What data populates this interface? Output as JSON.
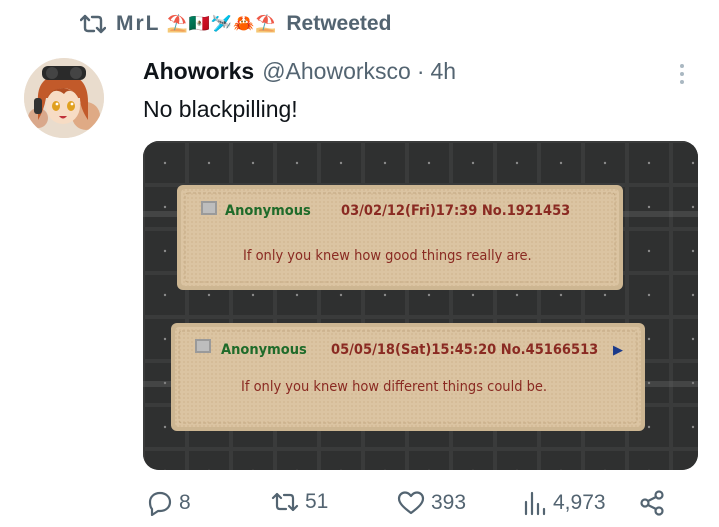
{
  "retweet": {
    "user": "MrL",
    "emojis": [
      "⛱️",
      "🇲🇽",
      "🛩️",
      "🦀",
      "⛱️"
    ],
    "label": "Retweeted"
  },
  "tweet": {
    "display_name": "Ahoworks",
    "handle": "@Ahoworksco",
    "separator": "·",
    "time": "4h",
    "text": "No blackpilling!"
  },
  "media": {
    "patches": [
      {
        "name": "Anonymous",
        "meta": "03/02/12(Fri)17:39 No.1921453",
        "text": "If only you knew how good things really are."
      },
      {
        "name": "Anonymous",
        "meta": "05/05/18(Sat)15:45:20 No.45166513",
        "arrow": "▶",
        "text": "If only you knew how different things could be."
      }
    ]
  },
  "actions": {
    "replies": "8",
    "retweets": "51",
    "likes": "393",
    "views": "4,973"
  },
  "icons": {
    "retweet": "retweet-icon",
    "more": "more-dots-icon",
    "reply": "reply-icon",
    "like": "heart-icon",
    "views": "views-icon",
    "share": "share-icon"
  },
  "colors": {
    "muted": "#536471",
    "text": "#0f1419",
    "patch_bg": "#dcc3a0",
    "patch_name": "#1f6b2a",
    "patch_text": "#8a2a22"
  }
}
